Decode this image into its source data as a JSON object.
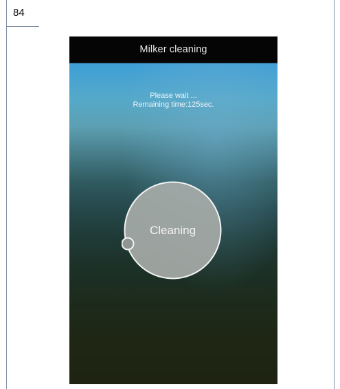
{
  "document": {
    "page_number": "84"
  },
  "app": {
    "title": "Milker cleaning",
    "status_line1": "Please wait ...",
    "status_line2": "Remaining time:125sec.",
    "button_label": "Cleaning"
  },
  "colors": {
    "header_background": "#050505",
    "ring_stroke": "#f2f2f2",
    "ring_fill": "#a6aba8"
  }
}
